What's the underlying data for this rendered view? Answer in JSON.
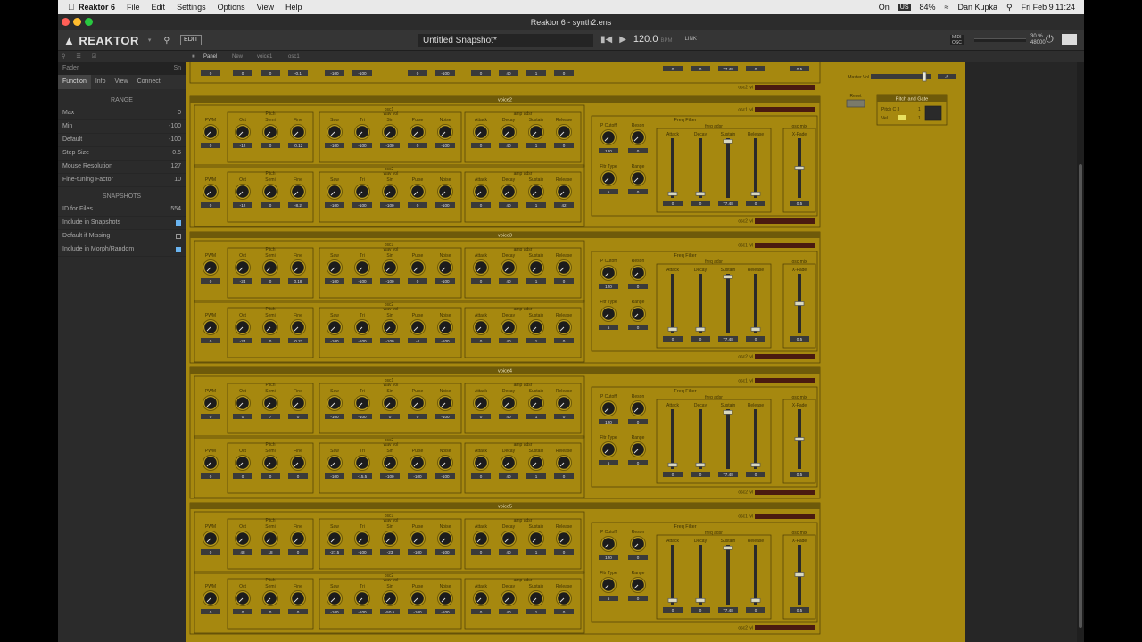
{
  "menubar": {
    "app": "Reaktor 6",
    "items": [
      "File",
      "Edit",
      "Settings",
      "Options",
      "View",
      "Help"
    ],
    "status": {
      "on_label": "On",
      "us": "US",
      "battery": "84%",
      "user": "Dan Kupka",
      "datetime": "Fri Feb 9  11:24"
    }
  },
  "window": {
    "title": "Reaktor 6 - synth2.ens"
  },
  "toolbar": {
    "logo": "REAKTOR",
    "edit": "EDIT",
    "snapshot": "Untitled Snapshot*",
    "bpm": "120.0",
    "bpm_unit": "BPM",
    "link": "LINK",
    "midi": "MIDI",
    "osc": "OSC",
    "cpu": "30 %",
    "samplerate": "48000"
  },
  "subbar": {
    "tabs": [
      "Panel",
      "New",
      "voice1",
      "osc1"
    ]
  },
  "sidebar": {
    "title": "Fader",
    "title_right": "Sn",
    "tabs": [
      "Function",
      "Info",
      "View",
      "Connect"
    ],
    "range_title": "RANGE",
    "range_rows": [
      {
        "label": "Max",
        "value": "0"
      },
      {
        "label": "Min",
        "value": "-100"
      },
      {
        "label": "Default",
        "value": "-100"
      },
      {
        "label": "Step Size",
        "value": "0.5"
      },
      {
        "label": "Mouse Resolution",
        "value": "127"
      },
      {
        "label": "Fine-tuning Factor",
        "value": "10"
      }
    ],
    "snap_title": "SNAPSHOTS",
    "snap_rows": [
      {
        "label": "ID for Files",
        "value": "554"
      },
      {
        "label": "Include in Snapshots",
        "checked": true
      },
      {
        "label": "Default if Missing",
        "checked": false
      },
      {
        "label": "Include in Morph/Random",
        "checked": true
      }
    ]
  },
  "labels": {
    "pitch": "Pitch",
    "wav_vol": "wav vol",
    "amp_adsr": "amp adsr",
    "pwm": "PWM",
    "oct": "Oct",
    "semi": "Semi",
    "fine": "Fine",
    "saw": "Saw",
    "tri": "Tri",
    "sin": "Sin",
    "pulse": "Pulse",
    "noise": "Noise",
    "attack": "Attack",
    "decay": "Decay",
    "sustain": "Sustain",
    "release": "Release",
    "freq_filter": "Freq Filter",
    "freq_adsr": "freq adsr",
    "p_cutoff": "P Cutoff",
    "reson": "Reson",
    "fltr_type": "Fltr Type",
    "range": "Range",
    "osc_mix": "osc mix",
    "x_fade": "X-Fade",
    "osc1_lvl": "osc1 lvl",
    "osc2_lvl": "osc2 lvl",
    "master_vol": "Master Vol",
    "master_vol_value": "-5",
    "reset": "Reset",
    "pitch_and_gate": "Pitch and Gate",
    "pitch_note": "Pitch  C 3",
    "vel": "Vel",
    "pitch_count": "1",
    "vel_count": "1"
  },
  "voices": [
    {
      "name": "voice2",
      "osc1": {
        "title": "osc1",
        "pitch": [
          "0",
          "-12",
          "0",
          "-0.12"
        ],
        "wav": [
          "-100",
          "-100",
          "-100",
          "0",
          "-100"
        ],
        "adsr": [
          "0",
          "40",
          "1",
          "0"
        ]
      },
      "osc2": {
        "title": "osc2",
        "pitch": [
          "0",
          "-12",
          "0",
          "-8.2"
        ],
        "wav": [
          "-100",
          "-100",
          "-100",
          "0",
          "-100"
        ],
        "adsr": [
          "0",
          "40",
          "1",
          "42"
        ]
      },
      "filter": {
        "cutoff": "120",
        "reson": "0",
        "type": "5",
        "range": "0",
        "adsr": [
          "0",
          "0",
          "77.48",
          "0"
        ],
        "xfade": "0.5"
      }
    },
    {
      "name": "voice3",
      "osc1": {
        "title": "osc1",
        "pitch": [
          "0",
          "-24",
          "0",
          "0.18"
        ],
        "wav": [
          "-100",
          "-100",
          "-100",
          "0",
          "-100"
        ],
        "adsr": [
          "0",
          "40",
          "1",
          "0"
        ]
      },
      "osc2": {
        "title": "osc2",
        "pitch": [
          "0",
          "-24",
          "0",
          "-0.22"
        ],
        "wav": [
          "-100",
          "-100",
          "-100",
          "-4",
          "-100"
        ],
        "adsr": [
          "0",
          "40",
          "1",
          "0"
        ]
      },
      "filter": {
        "cutoff": "120",
        "reson": "0",
        "type": "5",
        "range": "0",
        "adsr": [
          "0",
          "0",
          "77.48",
          "0"
        ],
        "xfade": "0.5"
      }
    },
    {
      "name": "voice4",
      "osc1": {
        "title": "osc1",
        "pitch": [
          "0",
          "0",
          "7",
          "0"
        ],
        "wav": [
          "-100",
          "-100",
          "0",
          "0",
          "-100"
        ],
        "adsr": [
          "0",
          "40",
          "1",
          "0"
        ]
      },
      "osc2": {
        "title": "osc2",
        "pitch": [
          "0",
          "0",
          "0",
          "0"
        ],
        "wav": [
          "-100",
          "-15.5",
          "-100",
          "-100",
          "-100"
        ],
        "adsr": [
          "0",
          "40",
          "1",
          "0"
        ]
      },
      "filter": {
        "cutoff": "120",
        "reson": "0",
        "type": "5",
        "range": "0",
        "adsr": [
          "0",
          "0",
          "77.48",
          "0"
        ],
        "xfade": "0.5"
      }
    },
    {
      "name": "voice5",
      "osc1": {
        "title": "osc1",
        "pitch": [
          "0",
          "48",
          "18",
          "0"
        ],
        "wav": [
          "-27.5",
          "-100",
          "-23",
          "-100",
          "-100"
        ],
        "adsr": [
          "0",
          "40",
          "1",
          "0"
        ]
      },
      "osc2": {
        "title": "osc2",
        "pitch": [
          "0",
          "0",
          "0",
          "0"
        ],
        "wav": [
          "-100",
          "-100",
          "-50.5",
          "-100",
          "-100"
        ],
        "adsr": [
          "0",
          "40",
          "1",
          "0"
        ]
      },
      "filter": {
        "cutoff": "120",
        "reson": "0",
        "type": "5",
        "range": "0",
        "adsr": [
          "0",
          "0",
          "77.48",
          "0"
        ],
        "xfade": "0.5"
      }
    }
  ],
  "top_voice": {
    "pitch_values": [
      "0",
      "0",
      "0",
      "-0.1"
    ],
    "wav_values": [
      "-100",
      "-100",
      "0",
      "-100"
    ],
    "adsr_values": [
      "0",
      "40",
      "1",
      "0"
    ],
    "filter_adsr": [
      "0",
      "0",
      "77.48",
      "0"
    ],
    "xfade": "0.5"
  },
  "colors": {
    "panel": "#a6880f",
    "panel_line": "#4a3c06",
    "knob": "#1c1c1c",
    "value_bg": "#3a3a3a",
    "level_bar": "#4a1a10"
  }
}
